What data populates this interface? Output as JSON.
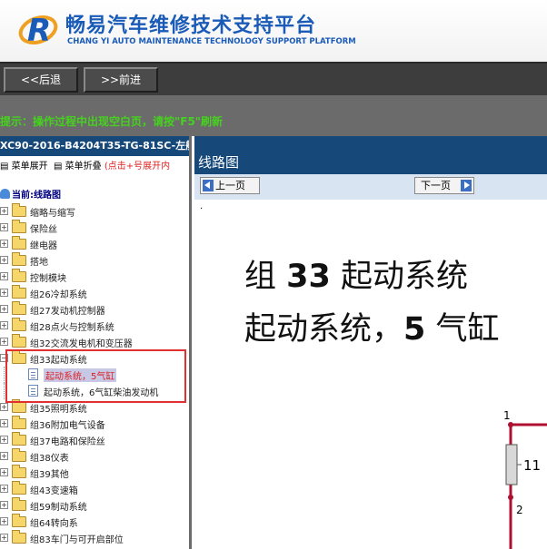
{
  "header": {
    "title": "畅易汽车维修技术支持平台",
    "subtitle": "CHANG YI AUTO MAINTENANCE TECHNOLOGY SUPPORT PLATFORM"
  },
  "nav": {
    "back_label": "<<后退",
    "forward_label": ">>前进"
  },
  "tip": "提示：操作过程中出现空白页，请按\"F5\"刷新",
  "left_panel": {
    "doc_title": "XC90-2016-B4204T35-TG-81SC-左舵",
    "menu_expand": "菜单展开",
    "menu_collapse": "菜单折叠",
    "menu_hint": "(点击+号展开内",
    "current_label": "当前:线路图",
    "tree": [
      {
        "label": "缩略与缩写"
      },
      {
        "label": "保险丝"
      },
      {
        "label": "继电器"
      },
      {
        "label": "搭地"
      },
      {
        "label": "控制模块"
      },
      {
        "label": "组26冷却系统"
      },
      {
        "label": "组27发动机控制器"
      },
      {
        "label": "组28点火与控制系统"
      },
      {
        "label": "组32交流发电机和变压器"
      },
      {
        "label": "组33起动系统",
        "expanded": true
      },
      {
        "label": "组35照明系统"
      },
      {
        "label": "组36附加电气设备"
      },
      {
        "label": "组37电路和保险丝"
      },
      {
        "label": "组38仪表"
      },
      {
        "label": "组39其他"
      },
      {
        "label": "组43变速箱"
      },
      {
        "label": "组59制动系统"
      },
      {
        "label": "组64转向系"
      },
      {
        "label": "组83车门与可开启部位"
      }
    ],
    "children": [
      {
        "label": "起动系统，5气缸",
        "active": true
      },
      {
        "label": "起动系统，6气缸柴油发动机"
      }
    ]
  },
  "right_panel": {
    "view_title": "线路图",
    "prev_label": "上一页",
    "next_label": "下一页",
    "dot": ".",
    "heading_line1_prefix": "组",
    "heading_line1_number": "33",
    "heading_line1_suffix": "起动系统",
    "heading_line2_prefix": "起动系统，",
    "heading_line2_number": "5",
    "heading_line2_suffix": "气缸",
    "wire_labels": [
      "1",
      "11",
      "2"
    ]
  },
  "colors": {
    "brand_blue": "#1a5bb8",
    "tip_green": "#46d11f",
    "title_bar": "#164879",
    "highlight_red": "#e03030",
    "wire_red": "#b01030"
  }
}
